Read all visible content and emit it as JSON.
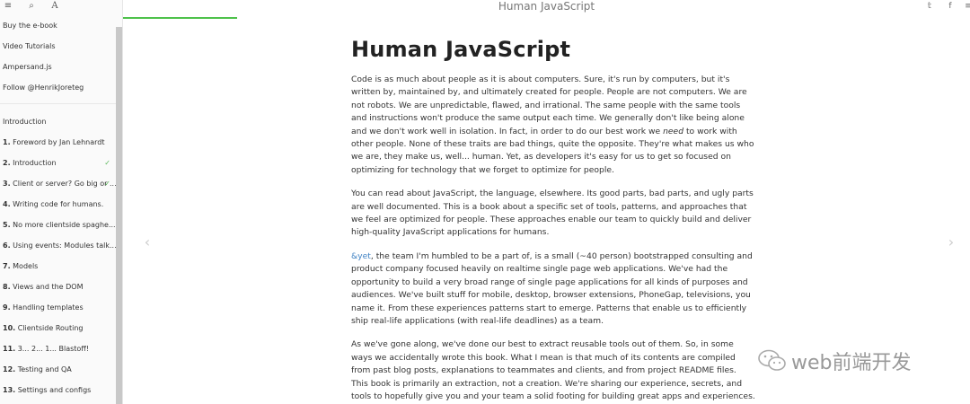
{
  "toolbar": {
    "menu_icon": "≡",
    "search_icon": "⌕",
    "font_icon": "A"
  },
  "sidebar": {
    "links": [
      {
        "label": "Buy the e-book"
      },
      {
        "label": "Video Tutorials"
      },
      {
        "label": "Ampersand.js"
      },
      {
        "label": "Follow @HenrikJoreteg"
      }
    ],
    "section_title": "Introduction",
    "chapters": [
      {
        "num": "1.",
        "label": "Foreword by Jan Lehnardt",
        "checked": false
      },
      {
        "num": "2.",
        "label": "Introduction",
        "checked": true
      },
      {
        "num": "3.",
        "label": "Client or server? Go big or ...",
        "checked": true
      },
      {
        "num": "4.",
        "label": "Writing code for humans.",
        "checked": false
      },
      {
        "num": "5.",
        "label": "No more clientside spaghe...",
        "checked": false
      },
      {
        "num": "6.",
        "label": "Using events: Modules talk...",
        "checked": false
      },
      {
        "num": "7.",
        "label": "Models",
        "checked": false
      },
      {
        "num": "8.",
        "label": "Views and the DOM",
        "checked": false
      },
      {
        "num": "9.",
        "label": "Handling templates",
        "checked": false
      },
      {
        "num": "10.",
        "label": "Clientside Routing",
        "checked": false
      },
      {
        "num": "11.",
        "label": "3... 2... 1... Blastoff!",
        "checked": false
      },
      {
        "num": "12.",
        "label": "Testing and QA",
        "checked": false
      },
      {
        "num": "13.",
        "label": "Settings and configs",
        "checked": false
      }
    ],
    "check_mark": "✓"
  },
  "header": {
    "title": "Human JavaScript",
    "twitter_icon": "𝕥",
    "facebook_icon": "f",
    "share_icon": "≡"
  },
  "progress_fraction": 0.135,
  "article": {
    "heading": "Human JavaScript",
    "p1_a": "Code is as much about people as it is about computers. Sure, it's run by computers, but it's written by, maintained by, and ultimately created for people. People are not computers. We are not robots. We are unpredictable, flawed, and irrational. The same people with the same tools and instructions won't produce the same output each time. We generally don't like being alone and we don't work well in isolation. In fact, in order to do our best work we ",
    "p1_em": "need",
    "p1_b": " to work with other people. None of these traits are bad things, quite the opposite. They're what makes us who we are, they make us, well... human. Yet, as developers it's easy for us to get so focused on optimizing for technology that we forget to optimize for people.",
    "p2": "You can read about JavaScript, the language, elsewhere. Its good parts, bad parts, and ugly parts are well documented. This is a book about a specific set of tools, patterns, and approaches that we feel are optimized for people. These approaches enable our team to quickly build and deliver high-quality JavaScript applications for humans.",
    "p3_link": "&yet",
    "p3": ", the team I'm humbled to be a part of, is a small (~40 person) bootstrapped consulting and product company focused heavily on realtime single page web applications. We've had the opportunity to build a very broad range of single page applications for all kinds of purposes and audiences. We've built stuff for mobile, desktop, browser extensions, PhoneGap, televisions, you name it. From these experiences patterns start to emerge. Patterns that enable us to efficiently ship real-life applications (with real-life deadlines) as a team.",
    "p4": "As we've gone along, we've done our best to extract reusable tools out of them. So, in some ways we accidentally wrote this book. What I mean is that much of its contents are compiled from past blog posts, explanations to teammates and clients, and from project README files. This book is primarily an extraction, not a creation. We're sharing our experience, secrets, and tools to hopefully give you and your team a solid footing for building great apps and experiences."
  },
  "nav": {
    "prev_icon": "‹",
    "next_icon": "›"
  },
  "watermark": {
    "text": "web前端开发"
  }
}
